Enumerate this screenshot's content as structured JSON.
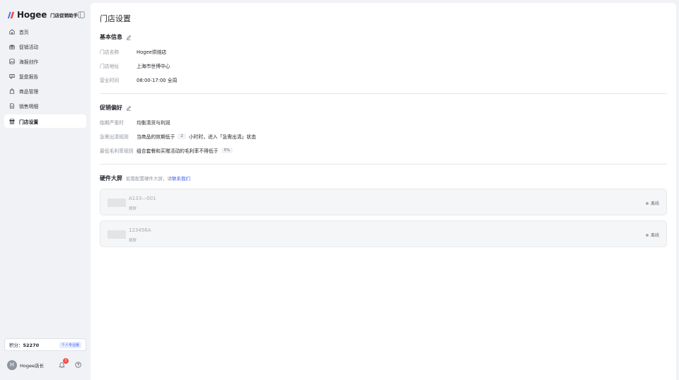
{
  "brand": {
    "name": "Hogee",
    "subtitle": "门店促销助手"
  },
  "sidebar": {
    "items": [
      {
        "label": "首页",
        "icon": "home-icon"
      },
      {
        "label": "促销活动",
        "icon": "gift-icon"
      },
      {
        "label": "海报创作",
        "icon": "image-icon"
      },
      {
        "label": "复盘报告",
        "icon": "chat-report-icon"
      },
      {
        "label": "商品管理",
        "icon": "bag-icon"
      },
      {
        "label": "销售明细",
        "icon": "document-icon"
      },
      {
        "label": "门店设置",
        "icon": "store-icon",
        "active": true
      }
    ],
    "points_label": "积分：",
    "points_value": "52270",
    "plan_badge": "个人专业版",
    "user_avatar_letter": "H",
    "user_name": "Hogee店长",
    "notification_count": "2"
  },
  "main": {
    "title": "门店设置",
    "basic": {
      "title": "基本信息",
      "rows": [
        {
          "key": "门店名称",
          "value": "Hogee烘焙店"
        },
        {
          "key": "门店地址",
          "value": "上海市世博中心"
        },
        {
          "key": "营业时间",
          "value": "08:00-17:00 全周"
        }
      ]
    },
    "promo": {
      "title": "促销偏好",
      "row1": {
        "key": "临期严重时",
        "value": "均衡清货与利润"
      },
      "row2": {
        "key": "急需出清规则",
        "before": "当商品的效期低于",
        "chip": "2",
        "after": "小时时，进入「急需出清」状态"
      },
      "row3": {
        "key": "最低毛利率规则",
        "before": "组合套餐和买赠活动的毛利率不得低于",
        "chip": "5%"
      }
    },
    "hardware": {
      "title": "硬件大屏",
      "hint": "如需配置硬件大屏，请",
      "link": "联系我们",
      "devices": [
        {
          "id": "A133—001",
          "type": "横屏",
          "status": "离线"
        },
        {
          "id": "123456A",
          "type": "横屏",
          "status": "离线"
        }
      ]
    }
  },
  "colors": {
    "accent": "#3d63f5",
    "notification": "#f54a45",
    "offline_dot": "#a6abb3"
  }
}
